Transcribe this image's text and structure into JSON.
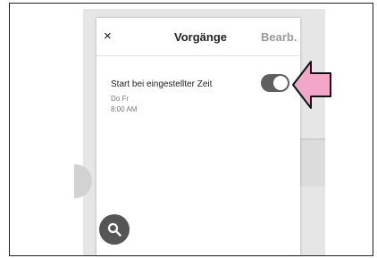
{
  "dialog": {
    "close_icon": "×",
    "title": "Vorgänge",
    "edit_label": "Bearb."
  },
  "item": {
    "title": "Start bei eingestellter Zeit",
    "days": "Do Fr",
    "time": "8:00 AM",
    "toggle_on": true
  },
  "icons": {
    "search": "search-icon",
    "pointer": "pointer-arrow"
  },
  "colors": {
    "toggle": "#5f5f5f",
    "fab": "#555555",
    "pointer_fill": "#f4a6c8"
  }
}
